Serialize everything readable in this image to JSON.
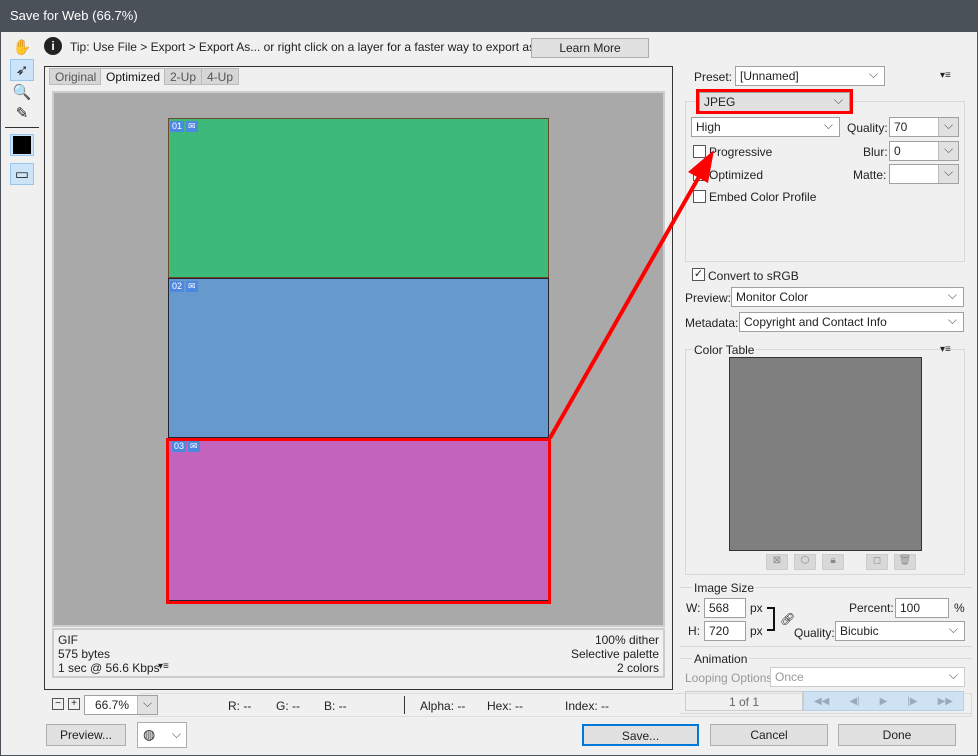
{
  "window": {
    "title": "Save for Web (66.7%)"
  },
  "tip": {
    "text": "Tip: Use File > Export > Export As...  or right click on a layer for a faster way to export assets",
    "learn_more": "Learn More"
  },
  "tabs": [
    "Original",
    "Optimized",
    "2-Up",
    "4-Up"
  ],
  "slices": [
    {
      "id": "01",
      "color": "#3dba7a"
    },
    {
      "id": "02",
      "color": "#6699cc"
    },
    {
      "id": "03",
      "color": "#c463bd"
    }
  ],
  "info": {
    "format": "GIF",
    "size": "575 bytes",
    "time": "1 sec @ 56.6 Kbps",
    "dither": "100% dither",
    "palette": "Selective palette",
    "colors": "2 colors"
  },
  "statusbar": {
    "zoom": "66.7%",
    "r": "R: --",
    "g": "G: --",
    "b": "B: --",
    "alpha": "Alpha: --",
    "hex": "Hex: --",
    "index": "Index: --"
  },
  "settings": {
    "preset_label": "Preset:",
    "preset": "[Unnamed]",
    "format": "JPEG",
    "quality_level": "High",
    "quality_label": "Quality:",
    "quality": "70",
    "blur_label": "Blur:",
    "blur": "0",
    "matte_label": "Matte:",
    "matte": "",
    "progressive": {
      "label": "Progressive",
      "checked": false
    },
    "optimized": {
      "label": "Optimized",
      "checked": true
    },
    "embed": {
      "label": "Embed Color Profile",
      "checked": false
    },
    "srgb": {
      "label": "Convert to sRGB",
      "checked": true
    },
    "preview_label": "Preview:",
    "preview": "Monitor Color",
    "metadata_label": "Metadata:",
    "metadata": "Copyright and Contact Info"
  },
  "color_table": {
    "title": "Color Table"
  },
  "image_size": {
    "title": "Image Size",
    "w_label": "W:",
    "w": "568",
    "h_label": "H:",
    "h": "720",
    "unit": "px",
    "percent_label": "Percent:",
    "percent": "100",
    "percent_unit": "%",
    "quality_label": "Quality:",
    "quality": "Bicubic"
  },
  "animation": {
    "title": "Animation",
    "looping_label": "Looping Options:",
    "looping": "Once",
    "frame": "1 of 1"
  },
  "buttons": {
    "preview": "Preview...",
    "save": "Save...",
    "cancel": "Cancel",
    "done": "Done"
  },
  "annotation": {
    "color": "#ff0000"
  }
}
